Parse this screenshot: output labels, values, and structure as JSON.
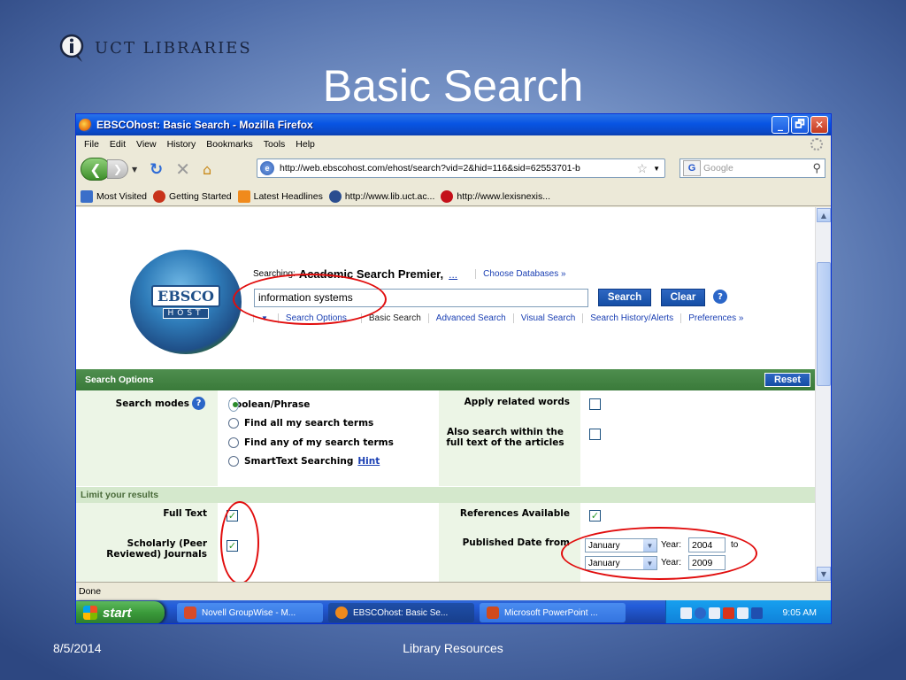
{
  "slide": {
    "logo_text": "UCT LIBRARIES",
    "title": "Basic Search",
    "footer_date": "8/5/2014",
    "footer_text": "Library Resources"
  },
  "window": {
    "title": "EBSCOhost: Basic Search - Mozilla Firefox",
    "controls": {
      "minimize": "_",
      "restore": "🗗",
      "close": "✕"
    }
  },
  "menu": [
    "File",
    "Edit",
    "View",
    "History",
    "Bookmarks",
    "Tools",
    "Help"
  ],
  "nav": {
    "url": "http://web.ebscohost.com/ehost/search?vid=2&hid=116&sid=62553701-b",
    "search_placeholder": "Google",
    "search_engine_letter": "G"
  },
  "bookmarks": [
    {
      "label": "Most Visited",
      "color": "#3a6fc9"
    },
    {
      "label": "Getting Started",
      "color": "#c8331b"
    },
    {
      "label": "Latest Headlines",
      "color": "#f08a1c"
    },
    {
      "label": "http://www.lib.uct.ac...",
      "color": "#2a4d8f"
    },
    {
      "label": "http://www.lexisnexis...",
      "color": "#c4101a"
    }
  ],
  "ebsco": {
    "logo_word": "EBSCO",
    "logo_sub": "HOST",
    "searching_label": "Searching:",
    "database": "Academic Search Premier,",
    "more": "...",
    "choose": "Choose Databases »",
    "query": "information systems",
    "search_btn": "Search",
    "clear_btn": "Clear",
    "help": "?",
    "nav": [
      "Search Options",
      "Basic Search",
      "Advanced Search",
      "Visual Search",
      "Search History/Alerts",
      "Preferences »"
    ]
  },
  "options": {
    "header": "Search Options",
    "reset": "Reset",
    "search_modes_label": "Search modes",
    "modes": [
      {
        "label": "Boolean/Phrase",
        "selected": true
      },
      {
        "label": "Find all my search terms",
        "selected": false
      },
      {
        "label": "Find any of my search terms",
        "selected": false
      },
      {
        "label": "SmartText Searching",
        "selected": false
      }
    ],
    "hint": "Hint",
    "apply_related": "Apply related words",
    "also_search_1": "Also search within the",
    "also_search_2": "full text of the articles"
  },
  "limits": {
    "header": "Limit your results",
    "full_text": "Full Text",
    "scholarly_1": "Scholarly (Peer",
    "scholarly_2": "Reviewed) Journals",
    "references": "References Available",
    "published": "Published Date from",
    "month_from": "January",
    "year_label": "Year:",
    "year_from": "2004",
    "to": "to",
    "month_to": "January",
    "year_to": "2009"
  },
  "status": "Done",
  "taskbar": {
    "start": "start",
    "tasks": [
      {
        "label": "Novell GroupWise - M...",
        "color": "#d84b2a",
        "active": false
      },
      {
        "label": "EBSCOhost: Basic Se...",
        "color": "#f08a1c",
        "active": true
      },
      {
        "label": "Microsoft PowerPoint ...",
        "color": "#d04a1c",
        "active": false
      }
    ],
    "clock": "9:05 AM"
  }
}
